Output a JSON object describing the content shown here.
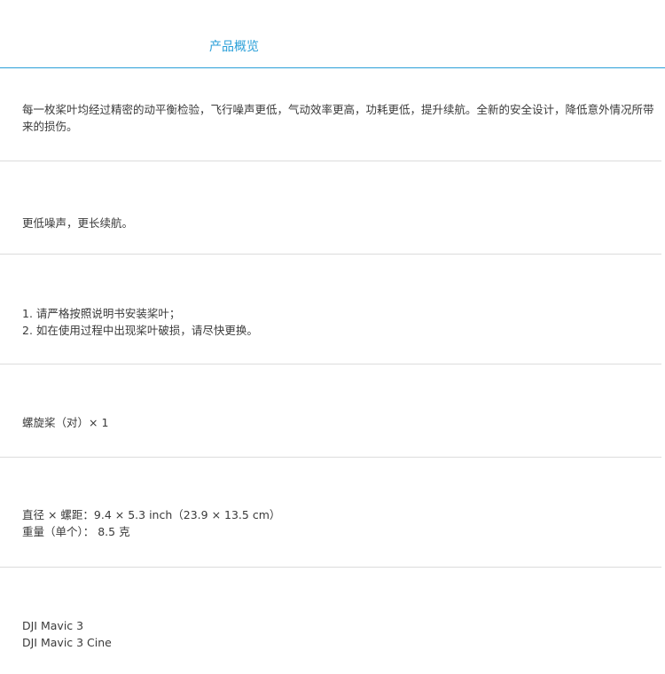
{
  "tabs": {
    "overview_label": "产品概览"
  },
  "accent_color": "#2a9fd8",
  "sections": {
    "description": {
      "text": "每一枚桨叶均经过精密的动平衡检验，飞行噪声更低，气动效率更高，功耗更低，提升续航。全新的安全设计，降低意外情况所带来的损伤。"
    },
    "highlight": {
      "text": "更低噪声，更长续航。"
    },
    "notes": {
      "line1": "1. 请严格按照说明书安装桨叶；",
      "line2": "2. 如在使用过程中出现桨叶破损，请尽快更换。"
    },
    "package": {
      "text": "螺旋桨（对）× 1"
    },
    "specs": {
      "line1": "直径 × 螺距：9.4 × 5.3 inch（23.9 × 13.5 cm）",
      "line2": "重量（单个）： 8.5 克"
    },
    "compatibility": {
      "line1": "DJI Mavic 3",
      "line2": "DJI Mavic 3 Cine"
    }
  }
}
